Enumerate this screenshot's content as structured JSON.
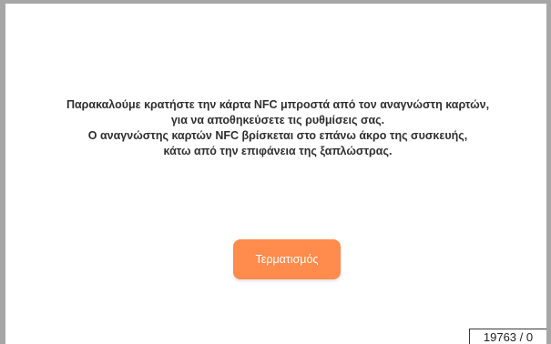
{
  "message": {
    "line1": "Παρακαλούμε κρατήστε την κάρτα NFC μπροστά από τον αναγνώστη καρτών,",
    "line2": "για να αποθηκεύσετε τις ρυθμίσεις σας.",
    "line3": "Ο αναγνώστης καρτών NFC βρίσκεται στο επάνω άκρο της συσκευής,",
    "line4": "κάτω από την επιφάνεια της ξαπλώστρας."
  },
  "actions": {
    "terminate_label": "Τερματισμός"
  },
  "status": {
    "counter": "19763 / 0"
  },
  "colors": {
    "accent": "#ff8b4c",
    "frame": "#a6a6a6",
    "text": "#2f2f2f"
  }
}
